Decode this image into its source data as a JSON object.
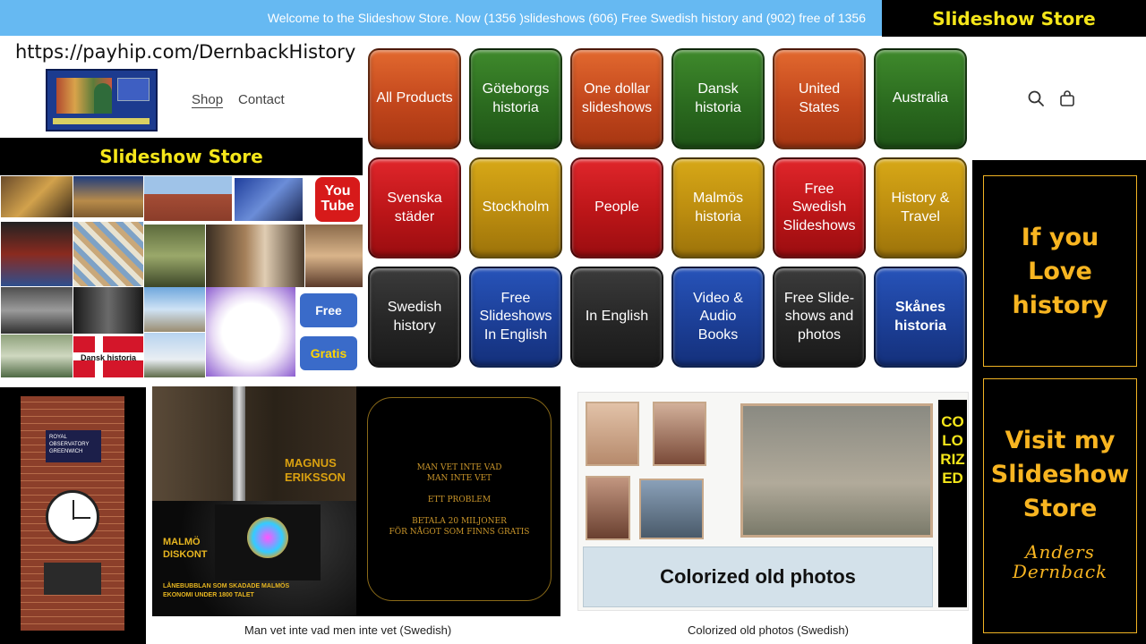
{
  "banner": {
    "text": "Welcome to the Slideshow Store. Now (1356 )slideshows (606) Free Swedish history and (902) free of 1356"
  },
  "store_label": "Slideshow Store",
  "site": {
    "url": "https://payhip.com/DernbackHistory",
    "nav": {
      "shop": "Shop",
      "contact": "Contact"
    },
    "icons": [
      "search-icon",
      "bag-icon"
    ]
  },
  "categories": [
    {
      "label": "All Products",
      "color": "orange"
    },
    {
      "label": "Göteborgs historia",
      "color": "green"
    },
    {
      "label": "One dollar slideshows",
      "color": "orange"
    },
    {
      "label": "Dansk historia",
      "color": "green"
    },
    {
      "label": "United States",
      "color": "orange"
    },
    {
      "label": "Australia",
      "color": "green"
    },
    {
      "label": "Svenska städer",
      "color": "red"
    },
    {
      "label": "Stockholm",
      "color": "yellow"
    },
    {
      "label": "People",
      "color": "red"
    },
    {
      "label": "Malmös historia",
      "color": "yellow"
    },
    {
      "label": "Free Swedish Slideshows",
      "color": "red"
    },
    {
      "label": "History & Travel",
      "color": "yellow"
    },
    {
      "label": "Swedish history",
      "color": "dark"
    },
    {
      "label": "Free Slideshows In English",
      "color": "blue"
    },
    {
      "label": "In English",
      "color": "dark"
    },
    {
      "label": "Video & Audio Books",
      "color": "blue"
    },
    {
      "label": "Free Slide-shows and photos",
      "color": "dark"
    },
    {
      "label": "Skånes historia",
      "color": "blue"
    }
  ],
  "collage": {
    "youtube": "You Tube",
    "free_button": "Free",
    "gratis_button": "Gratis",
    "dansk_label": "Dansk historia"
  },
  "clock_sign": "ROYAL OBSERVATORY GREENWICH",
  "promo": {
    "love": [
      "If you",
      "Love",
      "history"
    ],
    "visit": [
      "Visit my",
      "Slideshow",
      "Store"
    ],
    "author": [
      "Anders",
      "Dernback"
    ]
  },
  "products": [
    {
      "caption": "Man vet inte vad men inte vet (Swedish)",
      "magnus": [
        "MAGNUS",
        "ERIKSSON"
      ],
      "malmo": [
        "MALMÖ",
        "DISKONT"
      ],
      "malmo_sub": [
        "LÅNEBUBBLAN SOM SKADADE MALMÖS",
        "EKONOMI UNDER 1800 TALET"
      ],
      "quote": [
        "MAN VET INTE VAD",
        "MAN INTE VET",
        "ETT PROBLEM",
        "BETALA 20 MILJONER",
        "FÖR NÅGOT SOM FINNS GRATIS"
      ]
    },
    {
      "caption": "Colorized old photos (Swedish)",
      "title": "Colorized old photos",
      "vertical": "COLORIZED"
    }
  ],
  "colors": {
    "banner": "#66b9f2",
    "store_label": "#f5e61a",
    "promo_gold": "#f8b521"
  }
}
